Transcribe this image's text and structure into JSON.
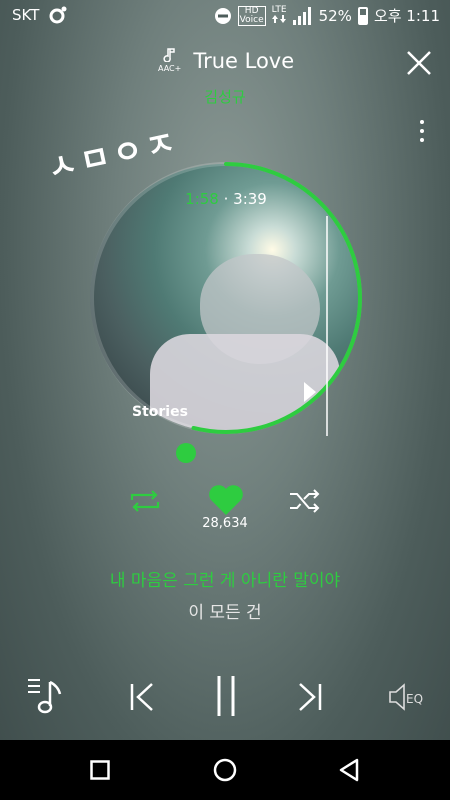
{
  "status": {
    "carrier": "SKT",
    "hd_voice": "HD\nVoice",
    "lte": "LTE",
    "battery": "52%",
    "time": "오후 1:11"
  },
  "player": {
    "format_badge": "AAC+",
    "title": "True Love",
    "artist": "김성규",
    "sticker": "ㅅㅁㅇㅈ",
    "time_current": "1:58",
    "time_separator": " · ",
    "time_total": "3:39",
    "progress": 0.539,
    "album_text": "Stories",
    "likes": "28,634",
    "lyric_current": "내 마음은 그런 게 아니란 말이야",
    "lyric_next": "이 모든 건",
    "accent_color": "#2ecc40"
  },
  "icons": {
    "close": "close-icon",
    "more": "more-vertical-icon",
    "repeat": "repeat-icon",
    "like": "heart-icon",
    "shuffle": "shuffle-icon",
    "playlist": "playlist-icon",
    "previous": "previous-icon",
    "pause": "pause-icon",
    "next": "next-icon",
    "eq": "equalizer-icon"
  },
  "eq_label": "EQ"
}
